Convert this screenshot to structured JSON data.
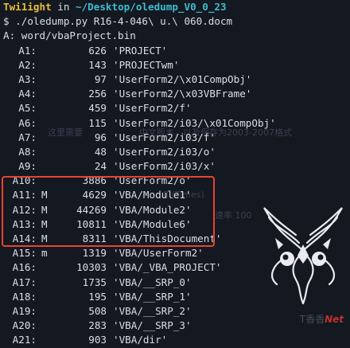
{
  "prompt": {
    "user": "Twi1ight",
    "in": " in ",
    "path": "~/Desktop/oledump_V0_0_23"
  },
  "command": "$ ./oledump.py R16-4-046\\ u.\\ 060.docm",
  "header_line": "A: word/vbaProject.bin",
  "streams": [
    {
      "idx": "A1:",
      "flag": "",
      "size": "626",
      "name": "'PROJECT'"
    },
    {
      "idx": "A2:",
      "flag": "",
      "size": "143",
      "name": "'PROJECTwm'"
    },
    {
      "idx": "A3:",
      "flag": "",
      "size": "97",
      "name": "'UserForm2/\\x01CompObj'"
    },
    {
      "idx": "A4:",
      "flag": "",
      "size": "256",
      "name": "'UserForm2/\\x03VBFrame'"
    },
    {
      "idx": "A5:",
      "flag": "",
      "size": "459",
      "name": "'UserForm2/f'"
    },
    {
      "idx": "A6:",
      "flag": "",
      "size": "115",
      "name": "'UserForm2/i03/\\x01CompObj'"
    },
    {
      "idx": "A7:",
      "flag": "",
      "size": "96",
      "name": "'UserForm2/i03/f'"
    },
    {
      "idx": "A8:",
      "flag": "",
      "size": "48",
      "name": "'UserForm2/i03/o'"
    },
    {
      "idx": "A9:",
      "flag": "",
      "size": "24",
      "name": "'UserForm2/i03/x'"
    },
    {
      "idx": "A10:",
      "flag": "",
      "size": "3886",
      "name": "'UserForm2/o'"
    },
    {
      "idx": "A11:",
      "flag": "M",
      "size": "4629",
      "name": "'VBA/Module1'"
    },
    {
      "idx": "A12:",
      "flag": "M",
      "size": "44269",
      "name": "'VBA/Module2'"
    },
    {
      "idx": "A13:",
      "flag": "M",
      "size": "10811",
      "name": "'VBA/Module6'"
    },
    {
      "idx": "A14:",
      "flag": "M",
      "size": "8311",
      "name": "'VBA/ThisDocument'"
    },
    {
      "idx": "A15:",
      "flag": "m",
      "size": "1319",
      "name": "'VBA/UserForm2'"
    },
    {
      "idx": "A16:",
      "flag": "",
      "size": "10303",
      "name": "'VBA/_VBA_PROJECT'"
    },
    {
      "idx": "A17:",
      "flag": "",
      "size": "1735",
      "name": "'VBA/__SRP_0'"
    },
    {
      "idx": "A18:",
      "flag": "",
      "size": "195",
      "name": "'VBA/__SRP_1'"
    },
    {
      "idx": "A19:",
      "flag": "",
      "size": "508",
      "name": "'VBA/__SRP_2'"
    },
    {
      "idx": "A20:",
      "flag": "",
      "size": "283",
      "name": "'VBA/__SRP_3'"
    },
    {
      "idx": "A21:",
      "flag": "",
      "size": "903",
      "name": "'VBA/dir'"
    }
  ],
  "ghost_texts": {
    "line1": "这里需要",
    "line2": "中文版本，以及保存为2003-2007格式",
    "line3": "8 (Times)",
    "line4": "速率 100"
  },
  "watermark": {
    "part1": "T香香",
    "part2": "Net"
  },
  "colors": {
    "background": "#141821",
    "highlight_border": "#e8442e",
    "prompt_user": "#e8bf3a",
    "prompt_path": "#3fbcd0"
  }
}
